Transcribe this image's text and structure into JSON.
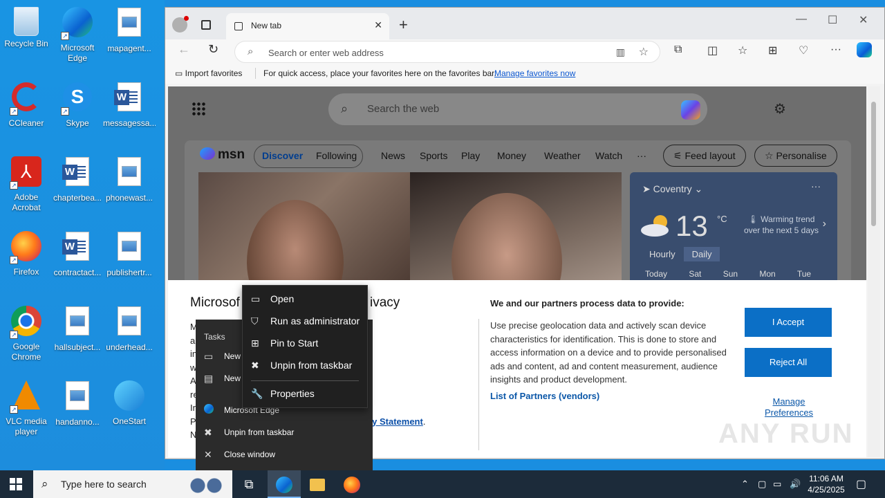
{
  "desktop": {
    "icons": [
      {
        "label": "Recycle Bin"
      },
      {
        "label": "Microsoft Edge"
      },
      {
        "label": "mapagent..."
      },
      {
        "label": "CCleaner"
      },
      {
        "label": "Skype"
      },
      {
        "label": "messagessa..."
      },
      {
        "label": "Adobe Acrobat"
      },
      {
        "label": "chapterbea..."
      },
      {
        "label": "phonewast..."
      },
      {
        "label": "Firefox"
      },
      {
        "label": "contractact..."
      },
      {
        "label": "publishertr..."
      },
      {
        "label": "Google Chrome"
      },
      {
        "label": "hallsubject..."
      },
      {
        "label": "underhead..."
      },
      {
        "label": "VLC media player"
      },
      {
        "label": "handanno..."
      },
      {
        "label": "OneStart"
      }
    ]
  },
  "browser": {
    "tab_title": "New tab",
    "address_placeholder": "Search or enter web address",
    "favbar": {
      "import": "Import favorites",
      "message": "For quick access, place your favorites here on the favorites bar.",
      "link": "Manage favorites now"
    }
  },
  "ntp": {
    "search_placeholder": "Search the web",
    "msn": {
      "logo": "msn",
      "nav": [
        "Discover",
        "Following",
        "News",
        "Sports",
        "Play",
        "Money",
        "Weather",
        "Watch",
        "···"
      ],
      "feed_layout": "Feed layout",
      "personalise": "Personalise"
    },
    "weather": {
      "city": "Coventry",
      "temp": "13",
      "unit": "°C",
      "trend": "Warming trend over the next 5 days",
      "tabs": [
        "Hourly",
        "Daily"
      ],
      "days": "Today Sat Sun Mon Tue"
    }
  },
  "consent": {
    "title_left": "Microsof",
    "title_right": "ivacy",
    "left_lines": [
      "M                          okies to store and",
      "a                          ver, maintain and",
      "in                         MSN and Microsoft Bing",
      "w                          use. You can select 'I",
      "A                          Manage preferences' to",
      "re                         object to Legitimate",
      "In                         ection under 'Manage",
      "P"
    ],
    "privacy_statement": "acy Statement",
    "last_left": "N",
    "right_heading": "We and our partners process data to provide:",
    "right_text": "Use precise geolocation data and actively scan device characteristics for identification. This is done to store and access information on a device and to provide personalised ads and content, ad and content measurement, audience insights and product development.",
    "list_partners": "List of Partners (vendors)",
    "accept": "I Accept",
    "reject": "Reject All",
    "manage": "Manage Preferences"
  },
  "watermark": "ANY RUN",
  "jumplist": {
    "header": "Tasks",
    "items": [
      {
        "label": "New"
      },
      {
        "label": "New"
      },
      {
        "label": "Microsoft Edge"
      },
      {
        "label": "Unpin from taskbar"
      },
      {
        "label": "Close window"
      }
    ]
  },
  "context_menu": {
    "items": [
      {
        "label": "Open"
      },
      {
        "label": "Run as administrator"
      },
      {
        "label": "Pin to Start"
      },
      {
        "label": "Unpin from taskbar"
      },
      {
        "label": "Properties"
      }
    ]
  },
  "taskbar": {
    "search_placeholder": "Type here to search",
    "time": "11:06 AM",
    "date": "4/25/2025"
  },
  "colors": {
    "desktop": "#1a8ee0",
    "accept_button": "#0b6fc6",
    "taskbar": "#1c2b3a"
  }
}
